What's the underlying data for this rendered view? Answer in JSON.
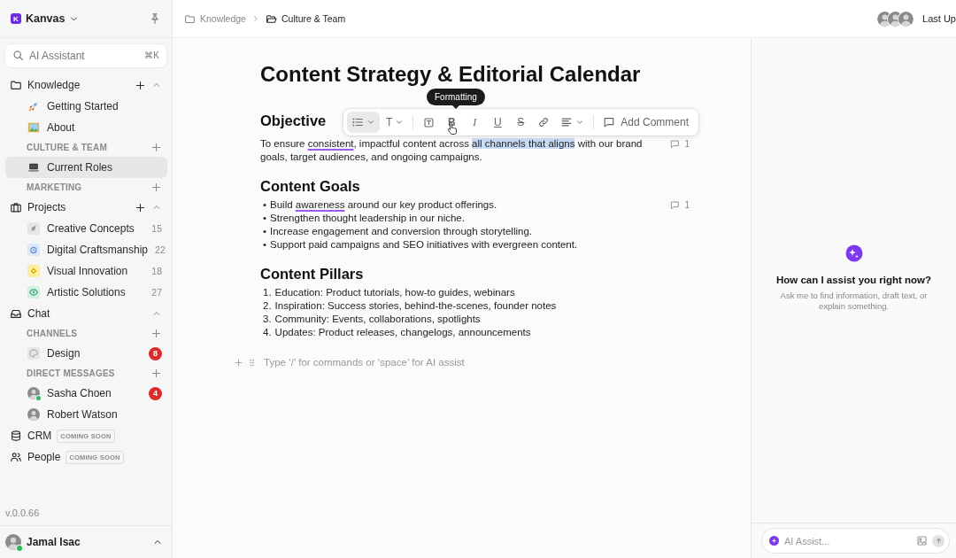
{
  "workspace": {
    "initial": "K",
    "name": "Kanvas"
  },
  "search": {
    "placeholder": "AI Assistant",
    "shortcut": "⌘K"
  },
  "nav": [
    {
      "kind": "section",
      "label": "Knowledge",
      "addable": true,
      "expanded": true,
      "children": [
        {
          "kind": "page",
          "label": "Getting Started",
          "selected": false
        },
        {
          "kind": "page",
          "label": "About",
          "selected": false
        },
        {
          "kind": "group",
          "label": "CULTURE & TEAM",
          "children": [
            {
              "kind": "page",
              "label": "Current Roles",
              "selected": true
            }
          ]
        },
        {
          "kind": "group",
          "label": "MARKETING"
        }
      ]
    },
    {
      "kind": "section",
      "label": "Projects",
      "addable": true,
      "expanded": true,
      "children": [
        {
          "kind": "project",
          "label": "Creative Concepts",
          "count": "15",
          "color": "#e6e6e6",
          "selected": false
        },
        {
          "kind": "project",
          "label": "Digital Craftsmanship",
          "count": "22",
          "color": "#dce7f7",
          "selected": false
        },
        {
          "kind": "project",
          "label": "Visual Innovation",
          "count": "18",
          "color": "#fbeea0",
          "selected": false
        },
        {
          "kind": "project",
          "label": "Artistic Solutions",
          "count": "27",
          "color": "#d4f0e2",
          "selected": false
        }
      ]
    },
    {
      "kind": "section",
      "label": "Chat",
      "addable": false,
      "expanded": true,
      "children": [
        {
          "kind": "group",
          "label": "CHANNELS",
          "children": [
            {
              "kind": "channel",
              "label": "Design",
              "badge": "8",
              "selected": false
            }
          ]
        },
        {
          "kind": "group",
          "label": "DIRECT MESSAGES",
          "children": [
            {
              "kind": "person",
              "label": "Sasha Choen",
              "badge": "4",
              "online": true,
              "selected": false
            },
            {
              "kind": "person",
              "label": "Robert Watson",
              "online": false,
              "selected": false
            }
          ]
        }
      ]
    },
    {
      "kind": "module",
      "label": "CRM",
      "tag": "COMING SOON"
    },
    {
      "kind": "module",
      "label": "People",
      "tag": "COMING SOON"
    }
  ],
  "version": "v.0.0.66",
  "user": {
    "name": "Jamal Isac",
    "online": true
  },
  "breadcrumb": [
    {
      "label": "Knowledge",
      "current": false
    },
    {
      "label": "Culture & Team",
      "current": true
    }
  ],
  "last_updated": "Last Up",
  "document": {
    "title": "Content Strategy & Editorial Calendar",
    "blocks": [
      {
        "kind": "heading",
        "text": "Objective"
      },
      {
        "kind": "paragraph",
        "comments": "1",
        "segments": [
          {
            "text": "To ensure "
          },
          {
            "text": "consistent",
            "misspelled": true
          },
          {
            "text": ", impactful content across "
          },
          {
            "text": "all channels that aligns",
            "highlighted": true
          },
          {
            "text": " with our brand goals, target audiences, and ongoing campaigns."
          }
        ]
      },
      {
        "kind": "heading",
        "text": "Content Goals"
      },
      {
        "kind": "bullets",
        "marker": "•",
        "comments": "1",
        "items": [
          {
            "segments": [
              {
                "text": "Build "
              },
              {
                "text": "awareness",
                "misspelled": true
              },
              {
                "text": " around our key product offerings."
              }
            ]
          },
          {
            "segments": [
              {
                "text": "Strengthen thought leadership in our niche."
              }
            ]
          },
          {
            "segments": [
              {
                "text": "Increase engagement and conversion through storytelling."
              }
            ]
          },
          {
            "segments": [
              {
                "text": "Support paid campaigns and SEO initiatives with evergreen content."
              }
            ]
          }
        ]
      },
      {
        "kind": "heading",
        "text": "Content Pillars"
      },
      {
        "kind": "numbered",
        "items": [
          {
            "number": "1.",
            "text": "Education: Product tutorials, how-to guides, webinars"
          },
          {
            "number": "2.",
            "text": "Inspiration: Success stories, behind-the-scenes, founder notes"
          },
          {
            "number": "3.",
            "text": "Community: Events, collaborations, spotlights"
          },
          {
            "number": "4.",
            "text": "Updates: Product releases, changelogs, announcements"
          }
        ]
      }
    ],
    "placeholder": "Type ‘/’ for commands or ‘space’ for AI assist"
  },
  "toolbar": {
    "tooltip": "Formatting",
    "tools": [
      {
        "kind": "list",
        "selected": true,
        "menu": true
      },
      {
        "kind": "text",
        "glyph": "T",
        "selected": false,
        "menu": true
      },
      {
        "kind": "divider"
      },
      {
        "kind": "box",
        "selected": false
      },
      {
        "kind": "bold",
        "glyph": "B",
        "selected": false
      },
      {
        "kind": "italic",
        "glyph": "I",
        "selected": false
      },
      {
        "kind": "underline",
        "glyph": "U",
        "selected": false
      },
      {
        "kind": "strike",
        "glyph": "S",
        "selected": false
      },
      {
        "kind": "link",
        "selected": false
      },
      {
        "kind": "align",
        "selected": false,
        "menu": true
      },
      {
        "kind": "divider"
      },
      {
        "kind": "comment",
        "label": "Add Comment",
        "selected": false
      }
    ]
  },
  "assistant": {
    "heading": "How can I assist you right now?",
    "description": "Ask me to find information, draft text, or explain something.",
    "placeholder": "AI Assist..."
  }
}
